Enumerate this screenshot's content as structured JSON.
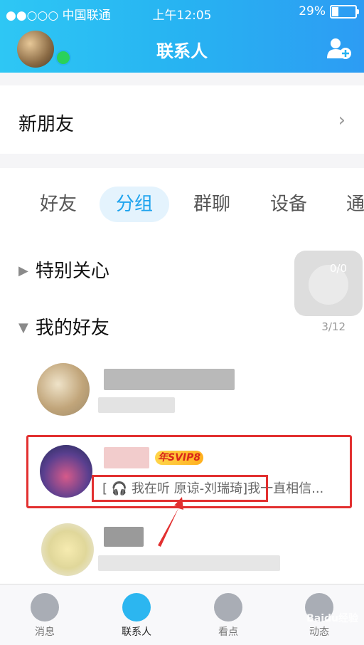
{
  "status_bar": {
    "carrier": "●●○○○ 中国联通",
    "time": "上午12:05",
    "battery": "29%"
  },
  "header": {
    "title": "联系人"
  },
  "new_friends": {
    "label": "新朋友",
    "chevron": "›"
  },
  "tabs": [
    {
      "label": "好友",
      "active": false
    },
    {
      "label": "分组",
      "active": true
    },
    {
      "label": "群聊",
      "active": false
    },
    {
      "label": "设备",
      "active": false
    },
    {
      "label": "通",
      "active": false
    }
  ],
  "groups": [
    {
      "name": "特别关心",
      "count": "0/0",
      "expanded": false
    },
    {
      "name": "我的好友",
      "count": "3/12",
      "expanded": true
    }
  ],
  "friends": [
    {
      "name": "",
      "status": "",
      "blurred": true
    },
    {
      "name": "",
      "badge": "年SVIP8",
      "status": "[ 🎧 我在听 原谅-刘瑞琦]我一直相信...",
      "highlighted": true
    },
    {
      "name": "",
      "status": "",
      "blurred": true
    }
  ],
  "tabbar": [
    {
      "label": "消息",
      "icon": "message-icon",
      "active": false
    },
    {
      "label": "联系人",
      "icon": "contacts-icon",
      "active": true
    },
    {
      "label": "看点",
      "icon": "eye-icon",
      "active": false
    },
    {
      "label": "动态",
      "icon": "star-icon",
      "active": false
    }
  ],
  "watermark": "Baidu经验",
  "colors": {
    "accent": "#27b3f2",
    "highlight_border": "#e23030",
    "active_tab": "#1da3ee"
  }
}
